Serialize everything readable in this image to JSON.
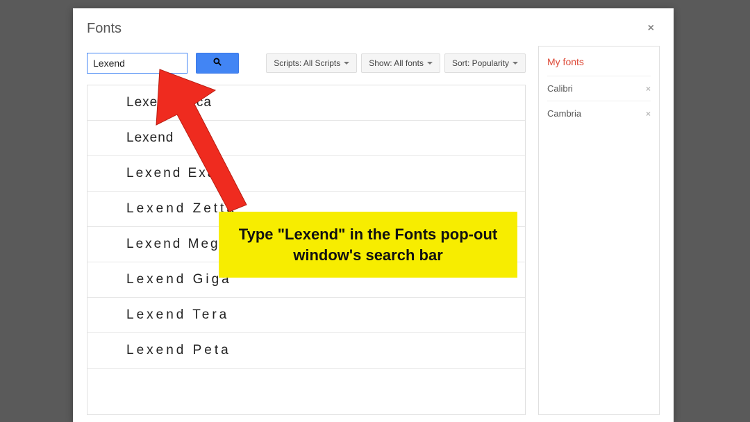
{
  "modal": {
    "title": "Fonts",
    "close_label": "×"
  },
  "search": {
    "value": "Lexend"
  },
  "filters": {
    "scripts": "Scripts: All Scripts",
    "show": "Show: All fonts",
    "sort": "Sort: Popularity"
  },
  "fonts": [
    "Lexend Deca",
    "Lexend",
    "Lexend Exa",
    "Lexend Zetta",
    "Lexend Mega",
    "Lexend Giga",
    "Lexend Tera",
    "Lexend Peta"
  ],
  "myfonts": {
    "title": "My fonts",
    "items": [
      "Calibri",
      "Cambria"
    ],
    "remove_label": "×"
  },
  "callout": {
    "text": "Type \"Lexend\" in the Fonts pop-out window's search bar"
  }
}
